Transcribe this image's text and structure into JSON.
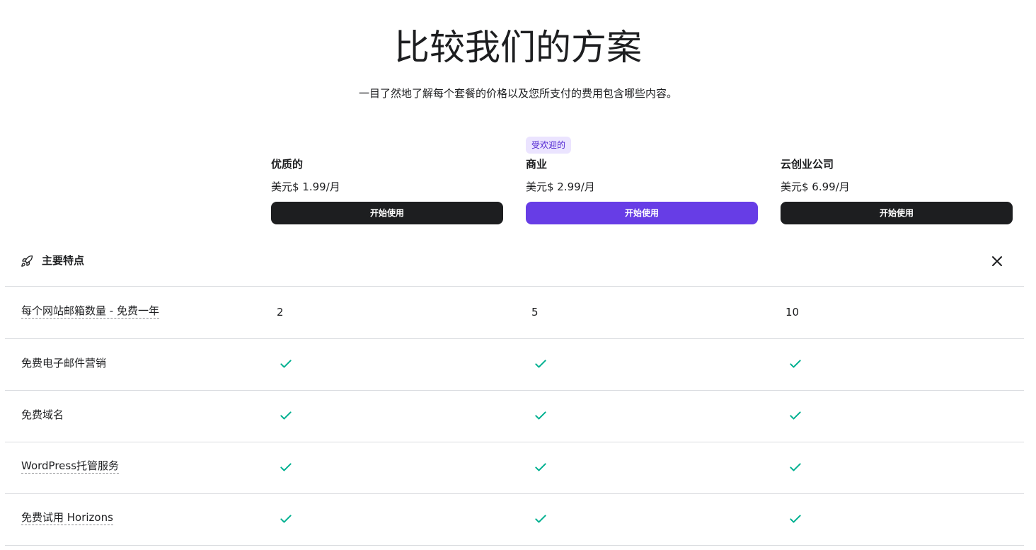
{
  "header": {
    "title": "比较我们的方案",
    "subtitle": "一目了然地了解每个套餐的价格以及您所支付的费用包含哪些内容。"
  },
  "plans": [
    {
      "name": "优质的",
      "price": "美元$ 1.99/月",
      "cta": "开始使用",
      "badge": ""
    },
    {
      "name": "商业",
      "price": "美元$ 2.99/月",
      "cta": "开始使用",
      "badge": "受欢迎的"
    },
    {
      "name": "云创业公司",
      "price": "美元$ 6.99/月",
      "cta": "开始使用",
      "badge": ""
    }
  ],
  "section": {
    "title": "主要特点",
    "icon": "rocket-icon",
    "close_icon": "close-icon"
  },
  "features": [
    {
      "label": "每个网站邮箱数量 - 免费一年",
      "values": [
        "2",
        "5",
        "10"
      ]
    },
    {
      "label": "免费电子邮件营销",
      "values": [
        "check",
        "check",
        "check"
      ]
    },
    {
      "label": "免费域名",
      "values": [
        "check",
        "check",
        "check"
      ]
    },
    {
      "label": "WordPress托管服务",
      "values": [
        "check",
        "check",
        "check"
      ]
    },
    {
      "label": "免费试用 Horizons",
      "values": [
        "check",
        "check",
        "check"
      ]
    }
  ],
  "colors": {
    "primary": "#673de6",
    "dark_button": "#1d1e20",
    "badge_bg": "#ebe4ff",
    "badge_text": "#5025d1",
    "check": "#00b090",
    "divider": "#dadce0"
  }
}
